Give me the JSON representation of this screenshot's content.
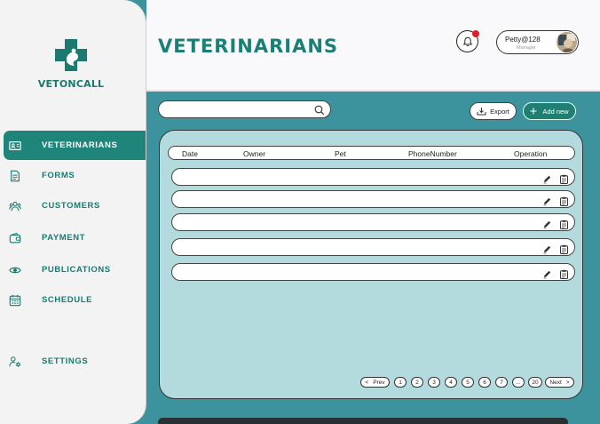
{
  "brand": {
    "name": "VETONCALL",
    "color": "#1a7a70"
  },
  "sidebar": {
    "items": [
      {
        "label": "VETERINARIANS",
        "icon": "id-card-icon",
        "active": true
      },
      {
        "label": "FORMS",
        "icon": "document-icon",
        "active": false
      },
      {
        "label": "CUSTOMERS",
        "icon": "users-icon",
        "active": false
      },
      {
        "label": "PAYMENT",
        "icon": "wallet-icon",
        "active": false
      },
      {
        "label": "PUBLICATIONS",
        "icon": "eye-icon",
        "active": false
      },
      {
        "label": "SCHEDULE",
        "icon": "calendar-icon",
        "active": false
      }
    ],
    "settings": {
      "label": "SETTINGS",
      "icon": "user-gear-icon"
    }
  },
  "header": {
    "title": "VETERINARIANS",
    "notification": {
      "icon": "bell-icon",
      "has_unread": true
    },
    "user": {
      "name": "Petty@128",
      "role": "Manager"
    }
  },
  "toolbar": {
    "search": {
      "placeholder": "",
      "value": "",
      "icon": "search-icon"
    },
    "export_label": "Export",
    "add_label": "Add new"
  },
  "table": {
    "columns": [
      "Date",
      "Owner",
      "Pet",
      "PhoneNumber",
      "Operation"
    ],
    "rows": [
      {
        "date": "",
        "owner": "",
        "pet": "",
        "phone": ""
      },
      {
        "date": "",
        "owner": "",
        "pet": "",
        "phone": ""
      },
      {
        "date": "",
        "owner": "",
        "pet": "",
        "phone": ""
      },
      {
        "date": "",
        "owner": "",
        "pet": "",
        "phone": ""
      },
      {
        "date": "",
        "owner": "",
        "pet": "",
        "phone": ""
      }
    ],
    "row_actions": [
      "pencil-icon",
      "clipboard-icon"
    ]
  },
  "pagination": {
    "prev_label": "Prev",
    "next_label": "Next",
    "pages": [
      "1",
      "2",
      "3",
      "4",
      "5",
      "6",
      "7",
      "...",
      "20"
    ]
  },
  "colors": {
    "accent": "#1f857a",
    "background": "#3c939d",
    "panel": "#b3dadc",
    "notification_dot": "#e0202a"
  }
}
